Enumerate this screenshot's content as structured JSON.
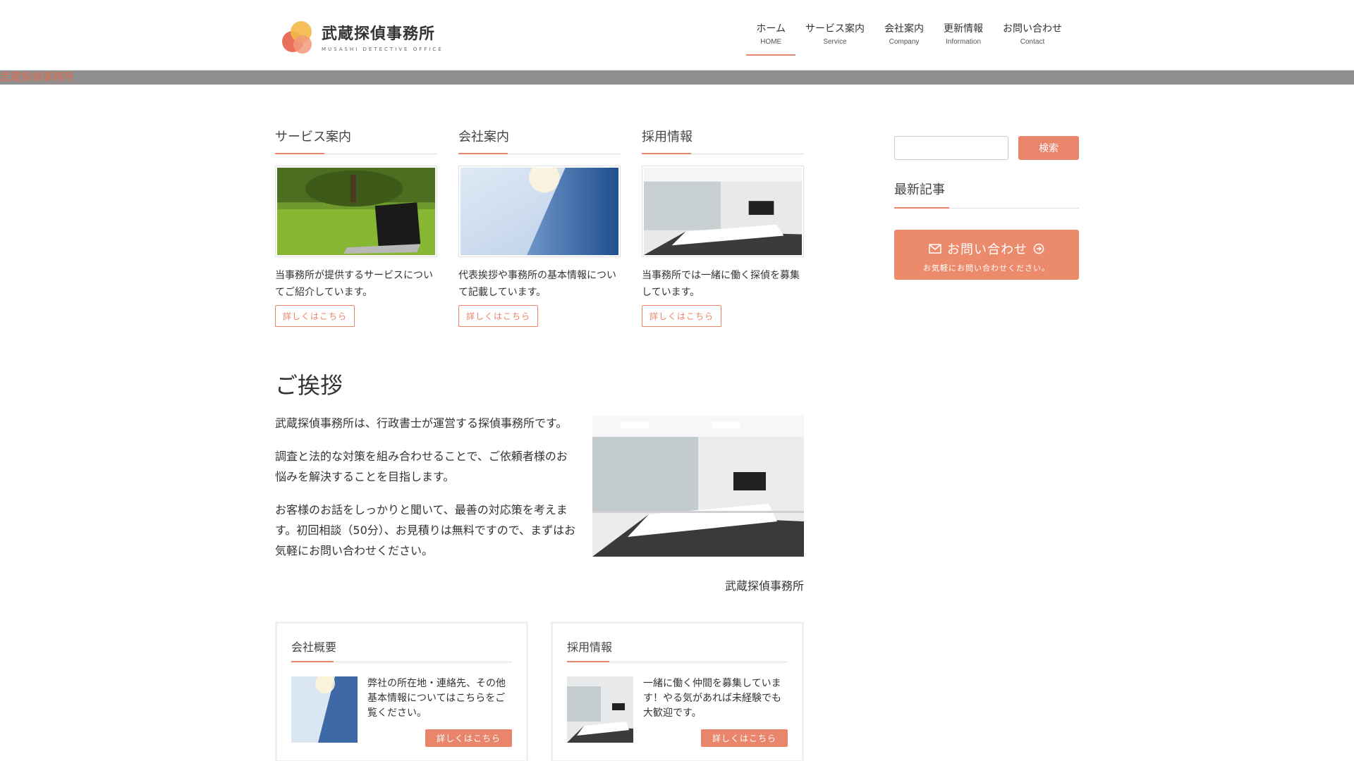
{
  "header": {
    "logo_title": "武蔵探偵事務所",
    "logo_sub": "MUSASHI DETECTIVE OFFICE",
    "nav": [
      {
        "jp": "ホーム",
        "en": "HOME"
      },
      {
        "jp": "サービス案内",
        "en": "Service"
      },
      {
        "jp": "会社案内",
        "en": "Company"
      },
      {
        "jp": "更新情報",
        "en": "Information"
      },
      {
        "jp": "お問い合わせ",
        "en": "Contact"
      }
    ]
  },
  "hero": {
    "broken_image_alt": "武蔵探偵事務所"
  },
  "cards": [
    {
      "title": "サービス案内",
      "desc": "当事務所が提供するサービスについてご紹介しています。",
      "button": "詳しくはこちら"
    },
    {
      "title": "会社案内",
      "desc": "代表挨拶や事務所の基本情報について記載しています。",
      "button": "詳しくはこちら"
    },
    {
      "title": "採用情報",
      "desc": "当事務所では一緒に働く探偵を募集しています。",
      "button": "詳しくはこちら"
    }
  ],
  "greeting": {
    "title": "ご挨拶",
    "paragraphs": [
      "武蔵探偵事務所は、行政書士が運営する探偵事務所です。",
      "調査と法的な対策を組み合わせることで、ご依頼者様のお悩みを解決することを目指します。",
      "お客様のお話をしっかりと聞いて、最善の対応策を考えます。初回相談（50分）、お見積りは無料ですので、まずはお気軽にお問い合わせください。"
    ],
    "signature": "武蔵探偵事務所"
  },
  "boxes": [
    {
      "title": "会社概要",
      "text": "弊社の所在地・連絡先、その他基本情報についてはこちらをご覧ください。",
      "button": "詳しくはこちら"
    },
    {
      "title": "採用情報",
      "text": "一緒に働く仲間を募集しています！やる気があれば未経験でも大歓迎です。",
      "button": "詳しくはこちら"
    }
  ],
  "sidebar": {
    "search_button": "検索",
    "recent_title": "最新記事",
    "contact_main": "お問い合わせ",
    "contact_sub": "お気軽にお問い合わせください。"
  },
  "colors": {
    "accent": "#e8856b"
  }
}
